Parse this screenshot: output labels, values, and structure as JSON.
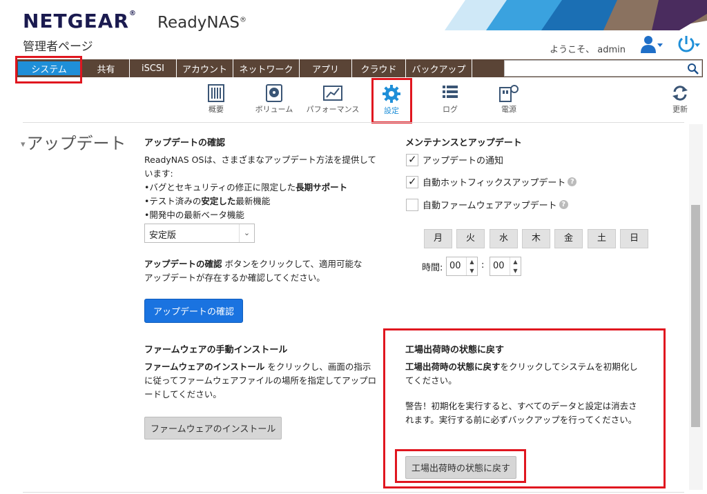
{
  "header": {
    "brand": "NETGEAR",
    "brand_reg": "®",
    "product": "ReadyNAS",
    "product_reg": "®",
    "subtitle": "管理者ページ",
    "welcome": "ようこそ、 admin"
  },
  "menu": {
    "items": [
      "システム",
      "共有",
      "iSCSI",
      "アカウント",
      "ネットワーク",
      "アプリ",
      "クラウド",
      "バックアップ"
    ],
    "search_placeholder": ""
  },
  "subnav": {
    "items": [
      {
        "label": "概要",
        "icon": "overview-icon"
      },
      {
        "label": "ボリューム",
        "icon": "volume-icon"
      },
      {
        "label": "パフォーマンス",
        "icon": "performance-icon"
      },
      {
        "label": "設定",
        "icon": "gear-icon"
      },
      {
        "label": "ログ",
        "icon": "log-icon"
      },
      {
        "label": "電源",
        "icon": "power-outlet-icon"
      },
      {
        "label": "更新",
        "icon": "refresh-icon"
      }
    ]
  },
  "section": {
    "title": "アップデート",
    "toggle": "▾"
  },
  "update_check": {
    "heading": "アップデートの確認",
    "intro": "ReadyNAS OSは、さまざまなアップデート方法を提供しています:",
    "bullet1_pre": "•バグとセキュリティの修正に限定した",
    "bullet1_bold": "長期サポート",
    "bullet2_pre": "•テスト済みの",
    "bullet2_bold": "安定した",
    "bullet2_post": "最新機能",
    "bullet3": "•開発中の最新ベータ機能",
    "channel_value": "安定版",
    "instruction_bold": "アップデートの確認",
    "instruction_rest": " ボタンをクリックして、適用可能なアップデートが存在するか確認してください。",
    "button_label": "アップデートの確認"
  },
  "firmware": {
    "heading": "ファームウェアの手動インストール",
    "instruction_bold": "ファームウェアのインストール",
    "instruction_rest": " をクリックし、画面の指示に従ってファームウェアファイルの場所を指定してアップロードしてください。",
    "button_label": "ファームウェアのインストール"
  },
  "maintenance": {
    "heading": "メンテナンスとアップデート",
    "notify_label": "アップデートの通知",
    "notify_checked": true,
    "hotfix_label": "自動ホットフィックスアップデート",
    "hotfix_checked": true,
    "firmware_label": "自動ファームウェアアップデート",
    "firmware_checked": false,
    "help": "?",
    "days": [
      "月",
      "火",
      "水",
      "木",
      "金",
      "土",
      "日"
    ],
    "time_label": "時間:",
    "hour": "00",
    "minute": "00",
    "colon": ":"
  },
  "factory": {
    "heading": "工場出荷時の状態に戻す",
    "instruction_bold": "工場出荷時の状態に戻す",
    "instruction_rest": "をクリックしてシステムを初期化してください。",
    "warning": "警告！初期化を実行すると、すべてのデータと設定は消去されます。実行する前に必ずバックアップを行ってください。",
    "button_label": "工場出荷時の状態に戻す"
  },
  "colors": {
    "brand": "#1a1a4f",
    "menubar": "#5a4436",
    "accent": "#1f8fd8",
    "button_blue": "#1a73e0",
    "highlight_red": "#e0161f"
  }
}
